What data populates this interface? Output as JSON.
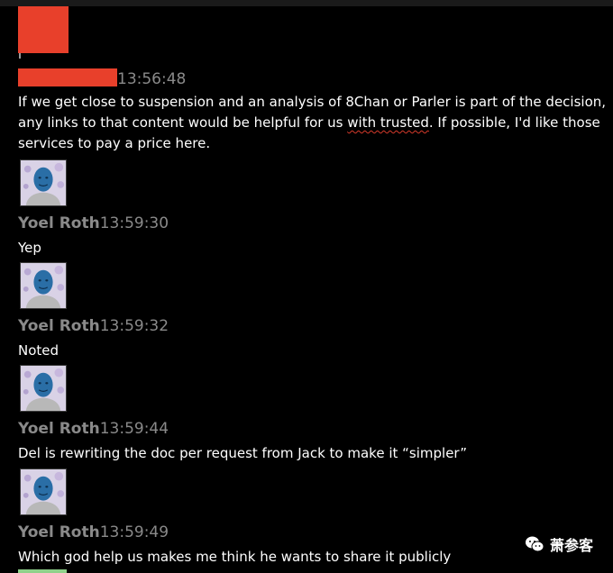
{
  "messages": [
    {
      "sender": "",
      "sender_redacted": true,
      "time": "13:56:48",
      "text_parts": [
        "If we get close to suspension and an analysis of 8Chan or Parler is part of the decision, any links to that content would be helpful for us ",
        "with trusted",
        ". If possible, I'd like those services to pay a price here."
      ]
    },
    {
      "sender": "Yoel Roth",
      "time": "13:59:30",
      "text": "Yep"
    },
    {
      "sender": "Yoel Roth",
      "time": "13:59:32",
      "text": "Noted"
    },
    {
      "sender": "Yoel Roth",
      "time": "13:59:44",
      "text": "Del is rewriting the doc per request from Jack to make it “simpler”"
    },
    {
      "sender": "Yoel Roth",
      "time": "13:59:49",
      "text": "Which god help us makes me think he wants to share it publicly"
    }
  ],
  "watermark": {
    "text": "萧参客",
    "icon": "wechat-icon"
  },
  "colors": {
    "background": "#000000",
    "redaction": "#e8402b",
    "meta": "#8a8a8a",
    "text": "#ffffff"
  }
}
